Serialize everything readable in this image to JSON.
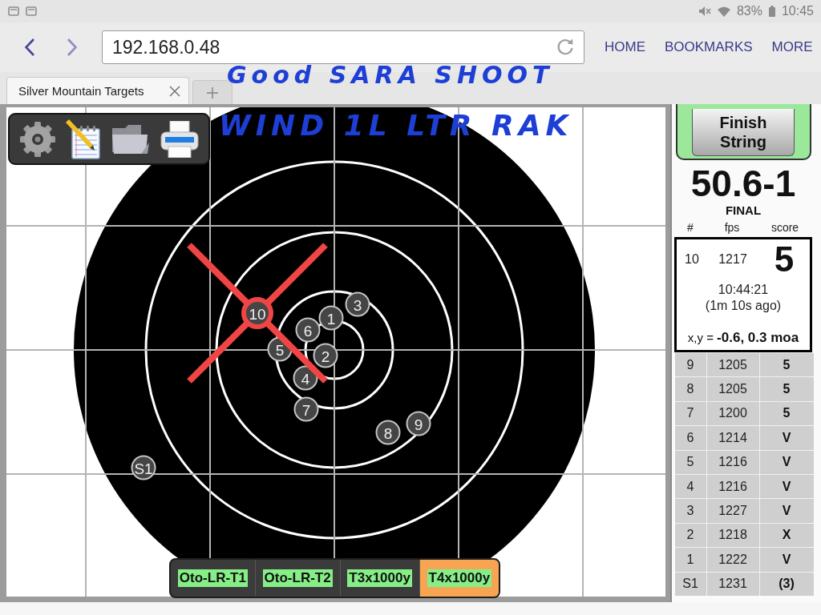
{
  "status_bar": {
    "battery": "83%",
    "time": "10:45"
  },
  "browser": {
    "url": "192.168.0.48",
    "menu": [
      "HOME",
      "BOOKMARKS",
      "MORE"
    ],
    "tabs": [
      {
        "title": "Silver Mountain Targets",
        "selected": true
      }
    ]
  },
  "handwritten_notes": [
    "Good SARA SHOOT",
    "WIND 1L LTR RAK"
  ],
  "target": {
    "shots": [
      {
        "label": "S1",
        "selected": false
      },
      {
        "label": "1",
        "selected": false
      },
      {
        "label": "2",
        "selected": false
      },
      {
        "label": "3",
        "selected": false
      },
      {
        "label": "4",
        "selected": false
      },
      {
        "label": "5",
        "selected": false
      },
      {
        "label": "6",
        "selected": false
      },
      {
        "label": "7",
        "selected": false
      },
      {
        "label": "8",
        "selected": false
      },
      {
        "label": "9",
        "selected": false
      },
      {
        "label": "10",
        "selected": true
      }
    ],
    "tabs": [
      {
        "label": "Oto-LR-T1",
        "selected": false
      },
      {
        "label": "Oto-LR-T2",
        "selected": false
      },
      {
        "label": "T3x1000y",
        "selected": false
      },
      {
        "label": "T4x1000y",
        "selected": true
      }
    ]
  },
  "score_panel": {
    "button": "Finish String",
    "total": "50.6-1",
    "status": "FINAL",
    "columns": [
      "#",
      "fps",
      "score"
    ],
    "latest": {
      "number": "10",
      "fps": "1217",
      "score": "5",
      "time": "10:44:21",
      "ago": "(1m 10s ago)",
      "position": "x,y = **-0.6, 0.3 moa**"
    },
    "rows": [
      {
        "number": "9",
        "fps": "1205",
        "score": "5"
      },
      {
        "number": "8",
        "fps": "1205",
        "score": "5"
      },
      {
        "number": "7",
        "fps": "1200",
        "score": "5"
      },
      {
        "number": "6",
        "fps": "1214",
        "score": "V"
      },
      {
        "number": "5",
        "fps": "1216",
        "score": "V"
      },
      {
        "number": "4",
        "fps": "1216",
        "score": "V"
      },
      {
        "number": "3",
        "fps": "1227",
        "score": "V"
      },
      {
        "number": "2",
        "fps": "1218",
        "score": "X"
      },
      {
        "number": "1",
        "fps": "1222",
        "score": "V"
      },
      {
        "number": "S1",
        "fps": "1231",
        "score": "(3)"
      }
    ]
  }
}
